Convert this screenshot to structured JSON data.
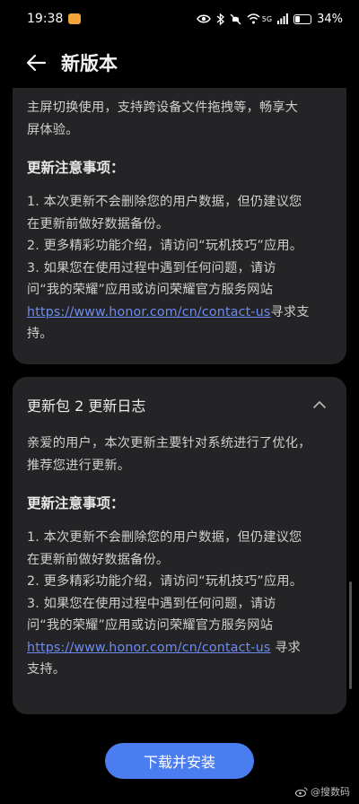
{
  "status_bar": {
    "time": "19:38",
    "battery": "34%",
    "network": "5G"
  },
  "header": {
    "title": "新版本"
  },
  "card1": {
    "intro_line1": "主屏切换使用，支持跨设备文件拖拽等，畅享大",
    "intro_line2": "屏体验。",
    "notice_title": "更新注意事项：",
    "item1_line1": "1. 本次更新不会删除您的用户数据，但仍建议您",
    "item1_line2": "在更新前做好数据备份。",
    "item2": "2. 更多精彩功能介绍，请访问“玩机技巧”应用。",
    "item3_line1": "3. 如果您在使用过程中遇到任何问题，请访",
    "item3_line2": "问“我的荣耀”应用或访问荣耀官方服务网站",
    "link": "https://www.honor.com/cn/contact-us",
    "item3_tail": "寻求支",
    "item3_end": "持。"
  },
  "card2": {
    "title": "更新包 2 更新日志",
    "intro_line1": "亲爱的用户，本次更新主要针对系统进行了优化，",
    "intro_line2": "推荐您进行更新。",
    "notice_title": "更新注意事项：",
    "item1_line1": "1. 本次更新不会删除您的用户数据，但仍建议您",
    "item1_line2": "在更新前做好数据备份。",
    "item2": "2. 更多精彩功能介绍，请访问“玩机技巧”应用。",
    "item3_line1": "3. 如果您在使用过程中遇到任何问题，请访",
    "item3_line2": "问“我的荣耀”应用或访问荣耀官方服务网站",
    "link": "https://www.honor.com/cn/contact-us",
    "item3_tail": " 寻求",
    "item3_end": "支持。"
  },
  "actions": {
    "install_label": "下载并安装"
  },
  "watermark": {
    "text": "@搜数码"
  },
  "colors": {
    "accent": "#4a7df0",
    "link": "#6e8bf2",
    "card": "#242426"
  }
}
